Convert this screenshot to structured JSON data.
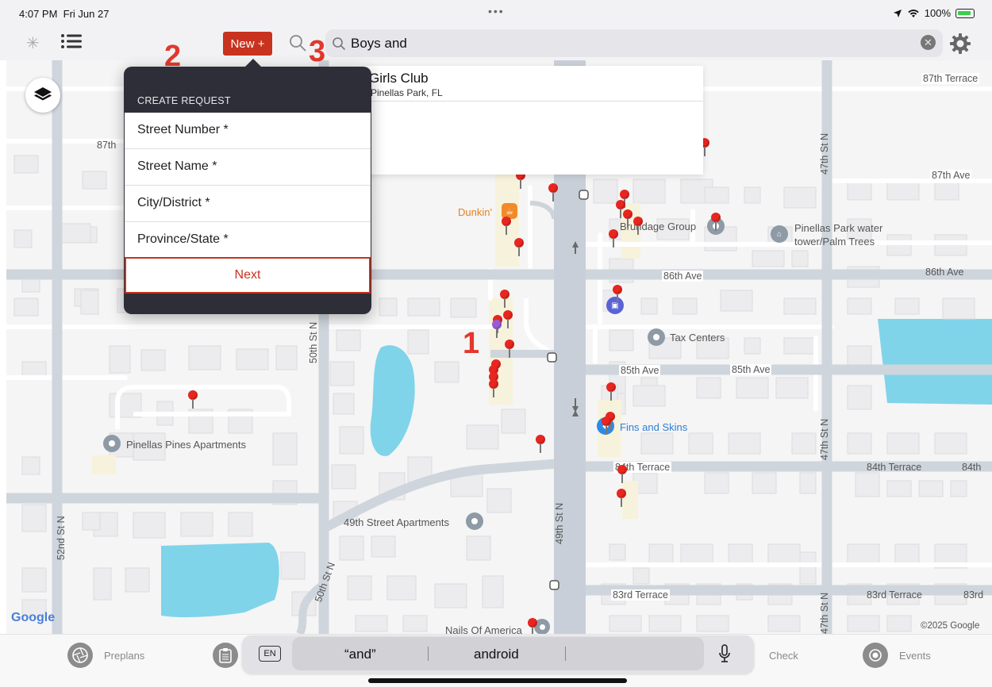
{
  "status": {
    "time": "4:07 PM",
    "date": "Fri Jun 27",
    "dots": "•••",
    "battery": "100%"
  },
  "toolbar": {
    "new_label": "New +",
    "search_value": "Boys and"
  },
  "steps": [
    "1",
    "2",
    "3"
  ],
  "popover": {
    "header": "CREATE REQUEST",
    "fields": [
      "Street Number *",
      "Street Name *",
      "City/District *",
      "Province/State *"
    ],
    "next_label": "Next"
  },
  "suggestion": {
    "title": "Girls Club",
    "subtitle": "Pinellas Park, FL"
  },
  "map": {
    "streets": {
      "t87_right": "87th Terrace",
      "t87_left": "87th",
      "ave87": "87th Ave",
      "ave86_mid": "86th Ave",
      "ave86_right": "86th Ave",
      "ave85_a": "85th Ave",
      "ave85_b": "85th Ave",
      "t84_mid": "84th Terrace",
      "t84_right": "84th Terrace",
      "t84_edge": "84th",
      "t83_mid": "83rd Terrace",
      "t83_right": "83rd Terrace",
      "t83_edge": "83rd",
      "st50": "50th St N",
      "st52": "52nd St N",
      "st49": "49th St N",
      "st47_top": "47th St N",
      "st47_mid": "47th St N",
      "st47_bot": "47th St N",
      "st50_lower": "50th St N"
    },
    "places": {
      "dunkin": "Dunkin'",
      "brundage": "Brundage Group",
      "water_tower_1": "Pinellas Park water",
      "water_tower_2": "tower/Palm Trees",
      "tax": "Tax Centers",
      "fins": "Fins and Skins",
      "pines": "Pinellas Pines Apartments",
      "apts49": "49th Street Apartments",
      "nails": "Nails Of America"
    },
    "google": "Google",
    "copyright": "©2025 Google"
  },
  "tabs": {
    "preplans": "Preplans",
    "check": "Check",
    "events": "Events"
  },
  "keyboard": {
    "lang": "EN",
    "pred1": "“and”",
    "pred2": "android"
  }
}
